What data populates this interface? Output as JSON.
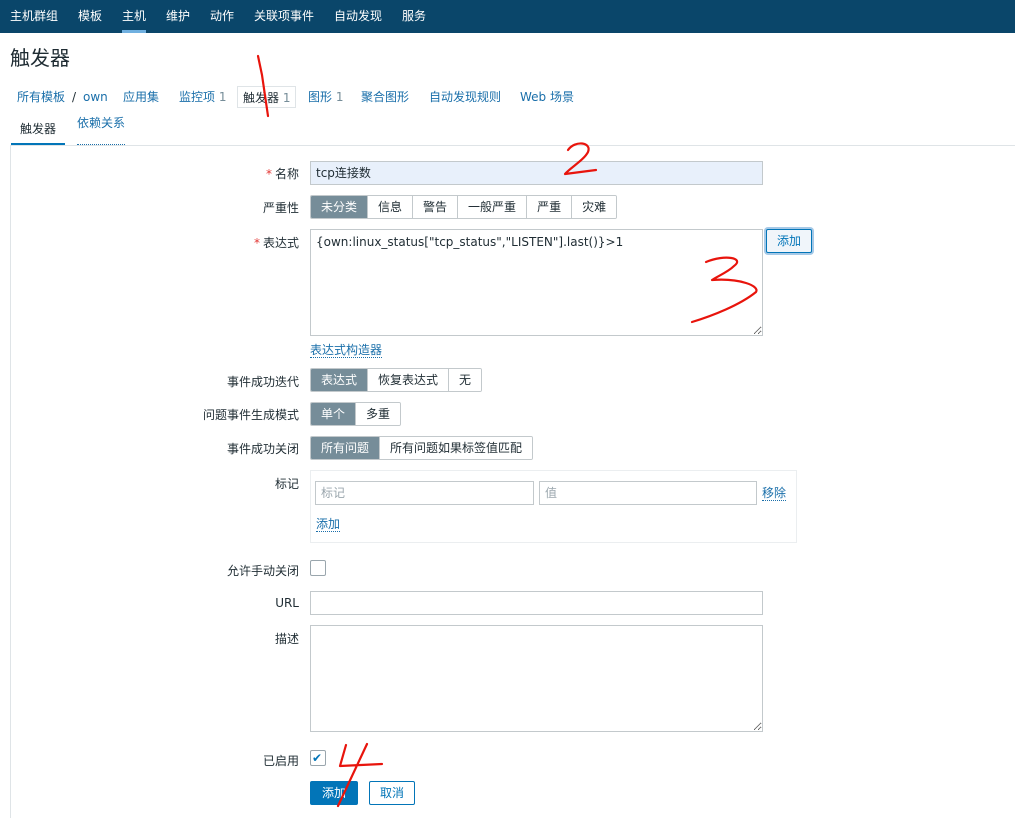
{
  "topnav": {
    "items": [
      "主机群组",
      "模板",
      "主机",
      "维护",
      "动作",
      "关联项事件",
      "自动发现",
      "服务"
    ]
  },
  "page_title": "触发器",
  "breadcrumb": {
    "all_templates": "所有模板",
    "separator": "/",
    "host": "own",
    "applications": "应用集",
    "items": "监控项",
    "items_count": "1",
    "triggers": "触发器",
    "triggers_count": "1",
    "graphs": "图形",
    "graphs_count": "1",
    "screens": "聚合图形",
    "discovery": "自动发现规则",
    "web": "Web 场景"
  },
  "tabs": {
    "trigger": "触发器",
    "dependencies": "依赖关系"
  },
  "form": {
    "name_label": "名称",
    "name_value": "tcp连接数",
    "severity_label": "严重性",
    "severity_options": [
      "未分类",
      "信息",
      "警告",
      "一般严重",
      "严重",
      "灾难"
    ],
    "severity_selected": "未分类",
    "expression_label": "表达式",
    "expression_value": "{own:linux_status[\"tcp_status\",\"LISTEN\"].last()}>1",
    "expression_add": "添加",
    "expression_builder": "表达式构造器",
    "ok_event_label": "事件成功迭代",
    "ok_event_options": [
      "表达式",
      "恢复表达式",
      "无"
    ],
    "problem_mode_label": "问题事件生成模式",
    "problem_mode_options": [
      "单个",
      "多重"
    ],
    "ok_close_label": "事件成功关闭",
    "ok_close_options": [
      "所有问题",
      "所有问题如果标签值匹配"
    ],
    "tags_label": "标记",
    "tag_placeholder": "标记",
    "value_placeholder": "值",
    "tag_remove": "移除",
    "tag_add": "添加",
    "manual_close_label": "允许手动关闭",
    "manual_close_checked": false,
    "url_label": "URL",
    "url_value": "",
    "description_label": "描述",
    "description_value": "",
    "enabled_label": "已启用",
    "enabled_checked": true,
    "submit": "添加",
    "cancel": "取消"
  },
  "annotations": [
    "1",
    "2",
    "3",
    "4"
  ],
  "colors": {
    "topnav_bg": "#0a466a",
    "accent": "#0275b8",
    "segment_selected": "#768d99",
    "link": "#1a6faa",
    "annotation": "#e8140c"
  }
}
